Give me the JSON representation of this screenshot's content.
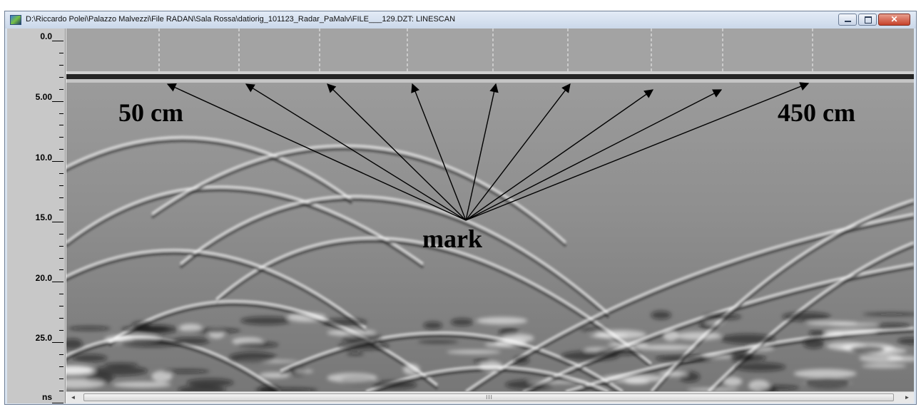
{
  "window": {
    "title": "D:\\Riccardo Polei\\Palazzo Malvezzi\\File RADAN\\Sala Rossa\\datiorig_101123_Radar_PaMalv\\FILE___129.DZT:  LINESCAN",
    "buttons": {
      "minimize": "minimize",
      "maximize": "maximize",
      "close": "close"
    }
  },
  "ruler": {
    "labels": [
      "0.0",
      "5.00",
      "10.0",
      "15.0",
      "20.0",
      "25.0"
    ],
    "unit": "ns"
  },
  "annotations": {
    "start_label": "50 cm",
    "end_label": "450 cm",
    "mark_label": "mark"
  },
  "scrollbar": {
    "grip": "III"
  },
  "colors": {
    "title_bg": "#d9e4f1",
    "ruler_bg": "#c8c8c8",
    "scan_bg": "#8e8e8e",
    "close_button": "#c7412a"
  }
}
